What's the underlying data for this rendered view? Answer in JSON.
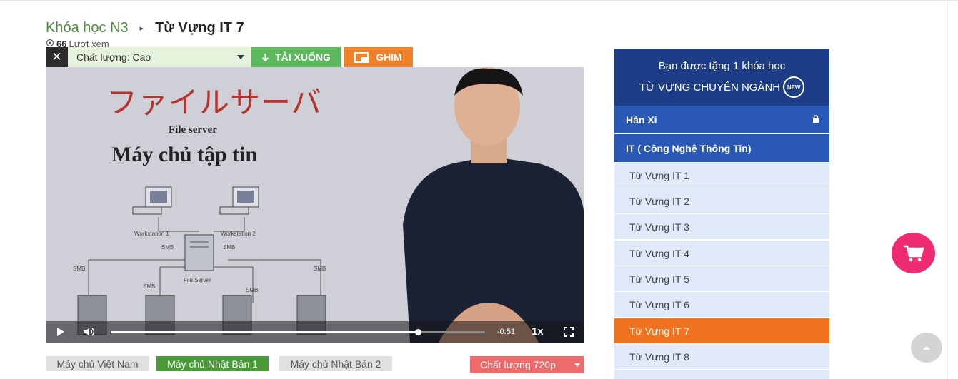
{
  "breadcrumb": {
    "course": "Khóa học N3",
    "separator": "▸",
    "current": "Từ Vựng IT 7"
  },
  "views": {
    "count": "66",
    "label": "Lượt xem"
  },
  "toolbar": {
    "close_label": "✕",
    "quality_label": "Chất lượng: Cao",
    "download_label": "TẢI XUỐNG",
    "pin_label": "GHIM"
  },
  "video": {
    "slide_title_jp": "ファイルサーバ",
    "slide_subtitle_en": "File server",
    "slide_title_vn": "Máy chủ tập tin",
    "diagram_labels": {
      "workstation1": "Workstation 1",
      "workstation2": "Workstation 2",
      "file_server": "File Server",
      "smb": "SMB"
    },
    "time_remaining": "-0:51",
    "playback_rate": "1x",
    "progress": 0.82
  },
  "servers": {
    "vn": "Máy chủ Việt Nam",
    "jp1": "Máy chủ Nhật Bản 1",
    "jp2": "Máy chủ Nhật Bản 2"
  },
  "quality_select": "Chất lượng 720p",
  "sidebar": {
    "promo_line1": "Bạn được tặng 1 khóa học",
    "promo_line2": "TỪ VỰNG CHUYÊN NGÀNH",
    "new_badge": "NEW",
    "categories": [
      {
        "label": "Hán Xi"
      },
      {
        "label": "IT ( Công Nghệ Thông Tin)"
      }
    ],
    "lessons": [
      {
        "label": "Từ Vựng IT 1"
      },
      {
        "label": "Từ Vựng IT 2"
      },
      {
        "label": "Từ Vựng IT 3"
      },
      {
        "label": "Từ Vựng IT 4"
      },
      {
        "label": "Từ Vựng IT 5"
      },
      {
        "label": "Từ Vựng IT 6"
      },
      {
        "label": "Từ Vựng IT 7"
      },
      {
        "label": "Từ Vựng IT 8"
      }
    ],
    "active_lesson": "Từ Vựng IT 7"
  },
  "colors": {
    "brand_blue": "#1d3e86",
    "category_blue": "#2a59b5",
    "active_orange": "#f0731f",
    "cart_pink": "#ef2b71",
    "download_green": "#5cb85c"
  },
  "icons": [
    "close-icon",
    "chevron-down-icon",
    "download-arrow-icon",
    "pip-icon",
    "play-icon",
    "volume-icon",
    "fullscreen-icon",
    "lock-icon",
    "cart-icon",
    "scroll-top-icon",
    "eye-icon"
  ]
}
